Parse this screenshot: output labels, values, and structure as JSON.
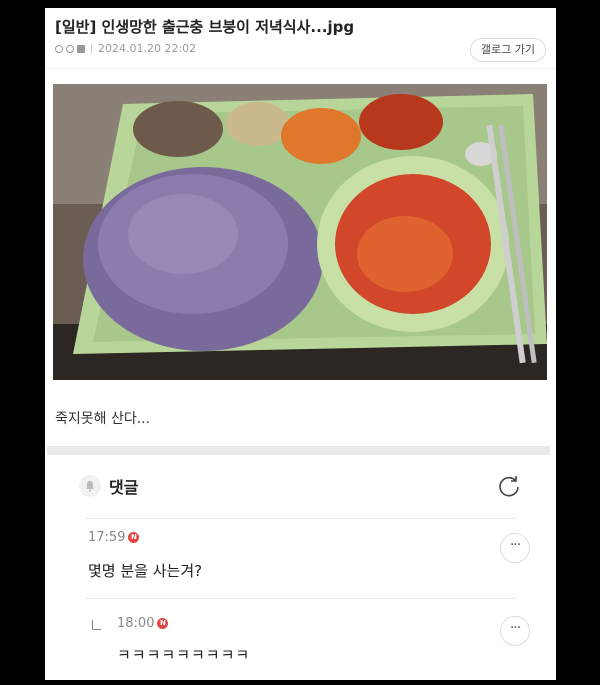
{
  "post": {
    "title": "[일반] 인생망한 출근충 브붕이 저녁식사...jpg",
    "date": "2024.01.20 22:02",
    "gallery_button": "갤로그 가기",
    "body": "죽지못해 산다..."
  },
  "comments": {
    "header_label": "댓글",
    "items": [
      {
        "time": "17:59",
        "badge": "N",
        "text": "몇명 분을 사는겨?",
        "more": "···"
      },
      {
        "time": "18:00",
        "badge": "N",
        "text": "ㅋㅋㅋㅋㅋㅋㅋㅋㅋ",
        "more": "···"
      }
    ]
  },
  "icons": [
    "author-icon",
    "photo-icon",
    "bell-icon",
    "refresh-icon",
    "more-icon",
    "reply-arrow-icon"
  ]
}
